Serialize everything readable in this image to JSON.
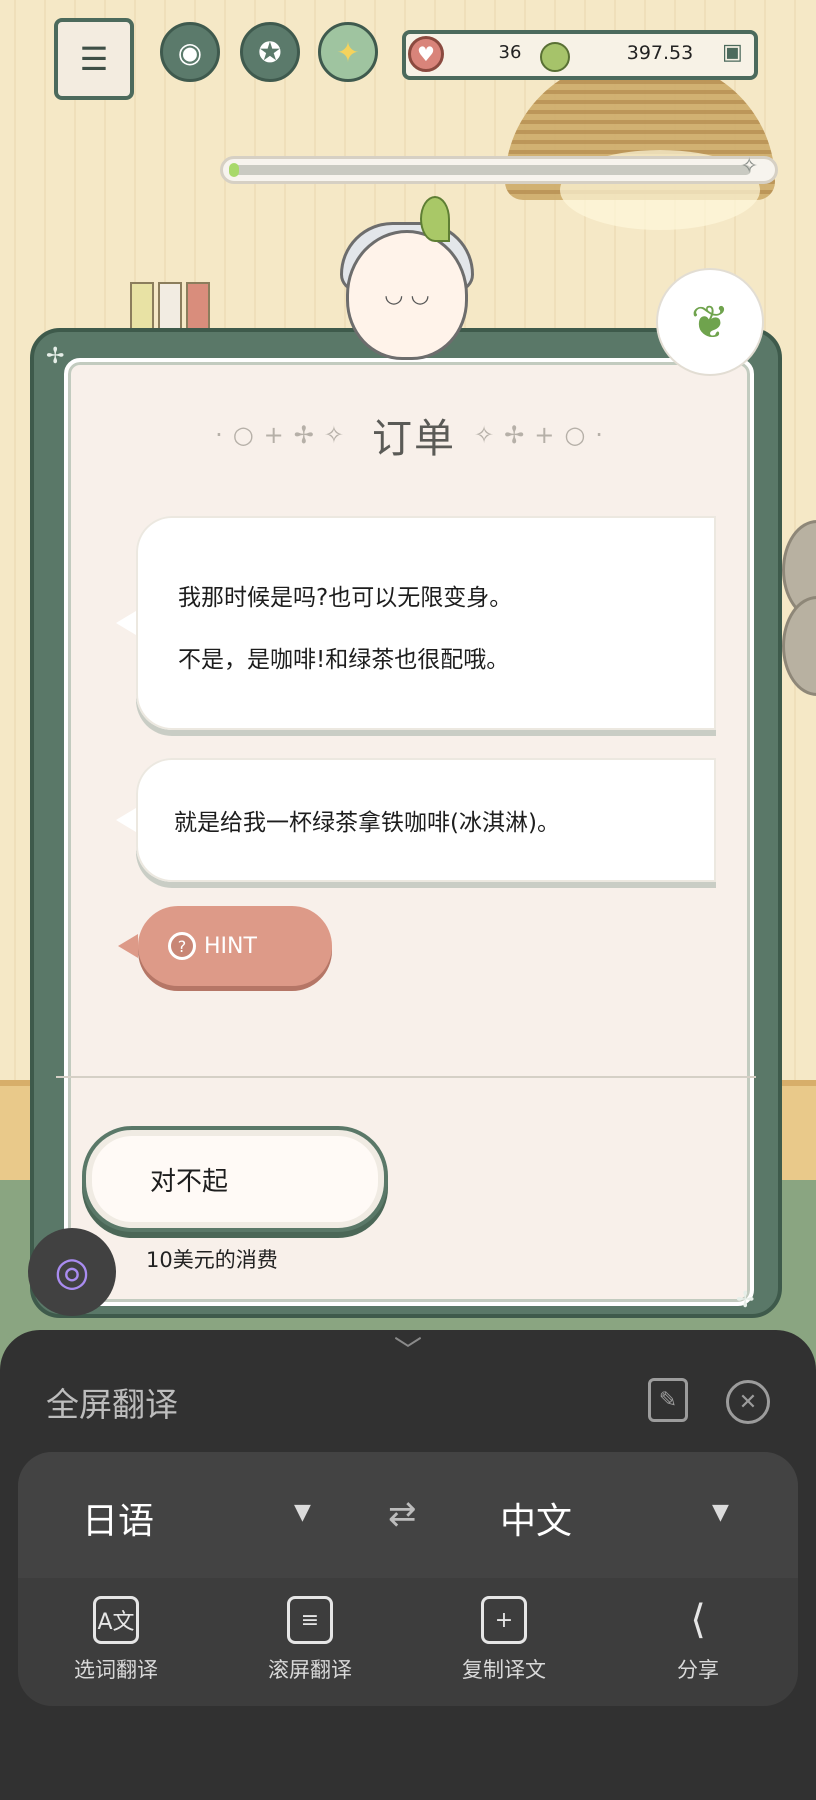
{
  "hud": {
    "hearts": "36",
    "money": "397.53"
  },
  "order": {
    "title": "订单",
    "messages": [
      {
        "lines": [
          "我那时候是吗?也可以无限变身。",
          "不是，是咖啡!和绿茶也很配哦。"
        ]
      },
      {
        "lines": [
          "就是给我一杯绿茶拿铁咖啡(冰淇淋)。"
        ]
      }
    ],
    "hint_label": "HINT",
    "hint_icon": "?",
    "reply_label": "对不起",
    "reply_cost": "10美元的消费"
  },
  "translator": {
    "title": "全屏翻译",
    "source_language": "日语",
    "target_language": "中文",
    "tools": [
      {
        "label": "选词翻译",
        "icon": "word-select-translate-icon"
      },
      {
        "label": "滚屏翻译",
        "icon": "scroll-translate-icon"
      },
      {
        "label": "复制译文",
        "icon": "copy-translation-icon"
      },
      {
        "label": "分享",
        "icon": "share-icon"
      }
    ]
  },
  "colors": {
    "card_frame": "#5a7868",
    "hint_bubble": "#dd9a88",
    "sheet_bg": "#313131"
  }
}
